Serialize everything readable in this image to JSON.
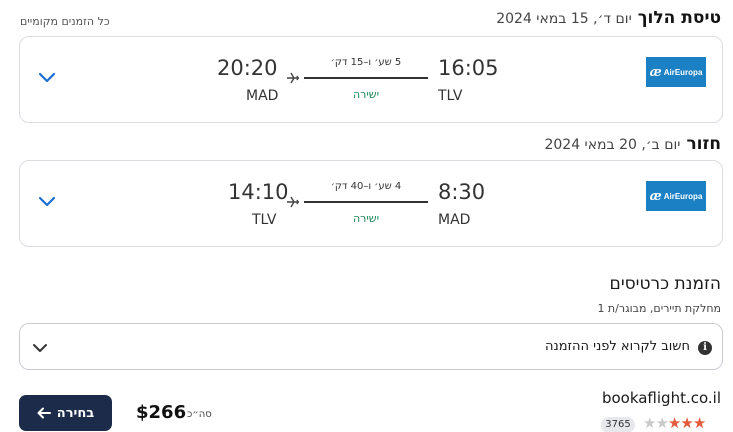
{
  "outbound": {
    "title": "טיסת הלוך",
    "date": "יום ד׳, 15 במאי 2024",
    "local_note": "כל הזמנים מקומיים",
    "airline": "AirEuropa",
    "depart_time": "16:05",
    "depart_code": "TLV",
    "arrive_time": "20:20",
    "arrive_code": "MAD",
    "duration": "5 שע׳ ו–15 דק׳",
    "stops": "ישירה"
  },
  "inbound": {
    "title": "חזור",
    "date": "יום ב׳, 20 במאי 2024",
    "airline": "AirEuropa",
    "depart_time": "8:30",
    "depart_code": "MAD",
    "arrive_time": "14:10",
    "arrive_code": "TLV",
    "duration": "4 שע׳ ו–40 דק׳",
    "stops": "ישירה"
  },
  "booking": {
    "title": "הזמנת כרטיסים",
    "subtitle": "מחלקת תיירים, מבוגר/ת 1",
    "notice": "חשוב לקרוא לפני ההזמנה",
    "select_label": "בחירה",
    "price": "$266",
    "total_label": "סה״כ",
    "vendor": "bookaflight.co.il",
    "review_count": "3765",
    "rating": 3
  },
  "colors": {
    "accent_blue": "#1b80c4",
    "chevron_blue": "#1a6fd1",
    "direct_green": "#1f8a5a",
    "button_navy": "#1c2b4a",
    "star_orange": "#e45b3c"
  },
  "icons": [
    "chevron-down-icon",
    "plane-icon",
    "info-icon",
    "arrow-left-icon",
    "star-icon"
  ]
}
